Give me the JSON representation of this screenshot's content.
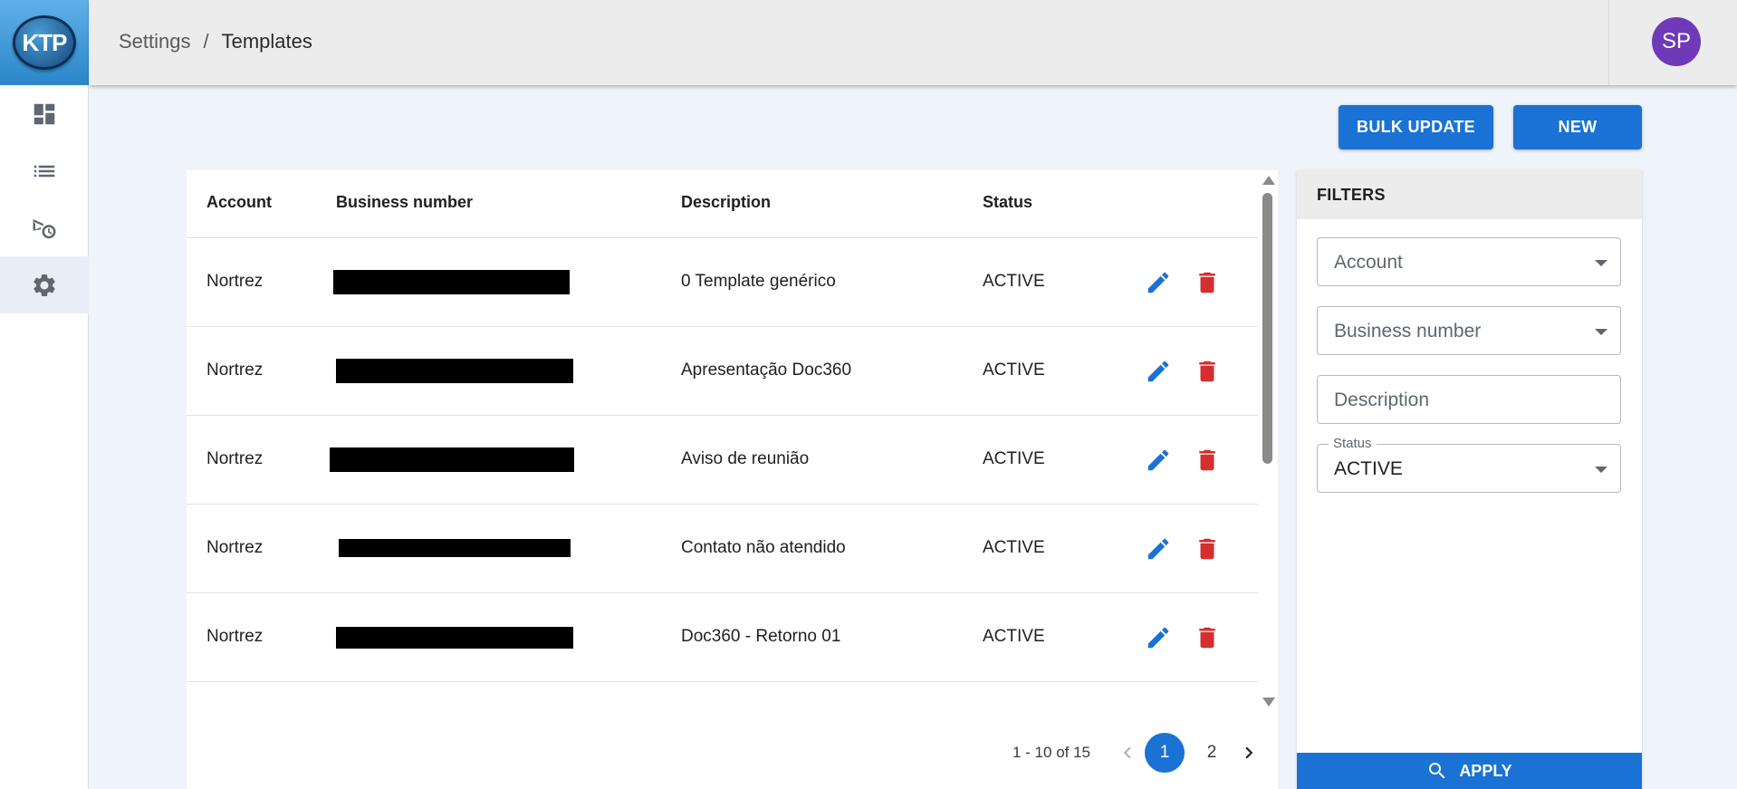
{
  "app": {
    "logo_text": "KTP",
    "user_initials": "SP",
    "colors": {
      "primary": "#1a72d4",
      "danger": "#d32f2f",
      "avatar": "#6f3ab8"
    }
  },
  "breadcrumb": {
    "parent": "Settings",
    "separator": "/",
    "current": "Templates"
  },
  "sidebar": {
    "items": [
      {
        "icon": "dashboard-icon"
      },
      {
        "icon": "list-icon"
      },
      {
        "icon": "campaign-history-icon"
      },
      {
        "icon": "settings-gear-icon",
        "active": true
      }
    ]
  },
  "toolbar": {
    "bulk_update_label": "BULK UPDATE",
    "new_label": "NEW"
  },
  "table": {
    "headers": {
      "account": "Account",
      "business_number": "Business number",
      "description": "Description",
      "status": "Status"
    },
    "rows": [
      {
        "account": "Nortrez",
        "business_number": "[redacted]",
        "description": "0 Template genérico",
        "status": "ACTIVE"
      },
      {
        "account": "Nortrez",
        "business_number": "[redacted]",
        "description": "Apresentação Doc360",
        "status": "ACTIVE"
      },
      {
        "account": "Nortrez",
        "business_number": "[redacted]",
        "description": "Aviso de reunião",
        "status": "ACTIVE"
      },
      {
        "account": "Nortrez",
        "business_number": "[redacted]",
        "description": "Contato não atendido",
        "status": "ACTIVE"
      },
      {
        "account": "Nortrez",
        "business_number": "[redacted]",
        "description": "Doc360 - Retorno 01",
        "status": "ACTIVE"
      }
    ],
    "row_action_icons": [
      "edit-pencil-icon",
      "delete-trash-icon"
    ]
  },
  "pagination": {
    "range_text": "1 - 10 of 15",
    "pages": [
      "1",
      "2"
    ],
    "current_page": "1"
  },
  "filters": {
    "title": "FILTERS",
    "account_placeholder": "Account",
    "business_number_placeholder": "Business number",
    "description_placeholder": "Description",
    "status_label": "Status",
    "status_value": "ACTIVE",
    "apply_label": "APPLY"
  }
}
